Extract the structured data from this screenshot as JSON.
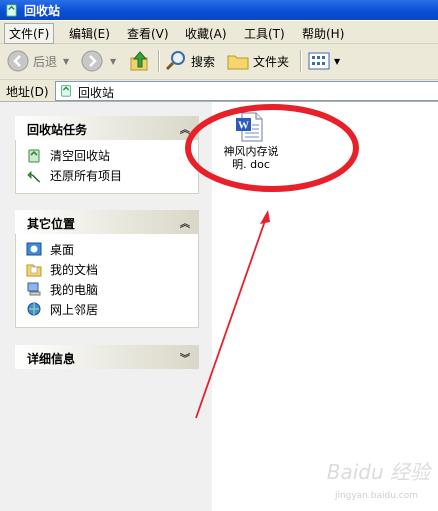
{
  "window": {
    "title": "回收站"
  },
  "menu": [
    "文件(F)",
    "编辑(E)",
    "查看(V)",
    "收藏(A)",
    "工具(T)",
    "帮助(H)"
  ],
  "toolbar": {
    "back": "后退",
    "search": "搜索",
    "folders": "文件夹"
  },
  "address": {
    "label": "地址(D)",
    "value": "回收站"
  },
  "tasks_panel": {
    "title": "回收站任务",
    "items": [
      "清空回收站",
      "还原所有项目"
    ]
  },
  "places_panel": {
    "title": "其它位置",
    "items": [
      "桌面",
      "我的文档",
      "我的电脑",
      "网上邻居"
    ]
  },
  "details_panel": {
    "title": "详细信息"
  },
  "file": {
    "name_line1": "神风内存说",
    "name_line2": "明. doc"
  },
  "watermark": {
    "brand": "Baidu 经验",
    "url": "jingyan.baidu.com"
  },
  "colors": {
    "titlebar": "#0a4fd6",
    "annotation": "#e8202a",
    "panel_bg": "#6b83d8"
  }
}
